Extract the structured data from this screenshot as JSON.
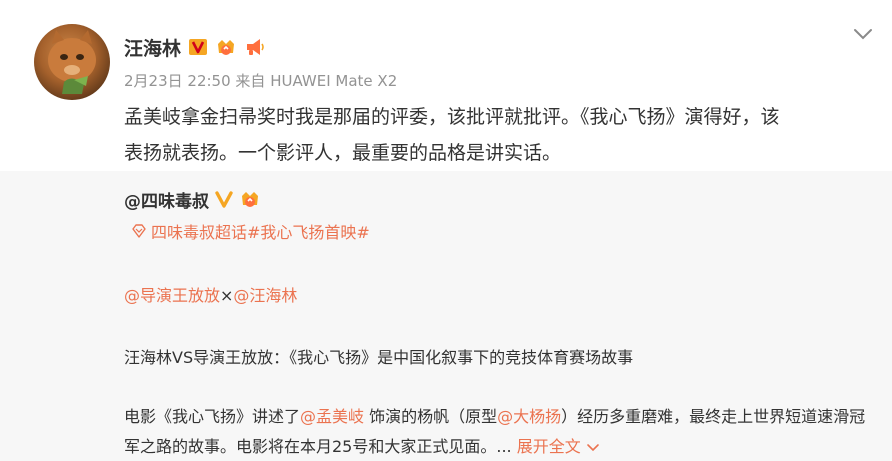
{
  "post": {
    "author": "汪海林",
    "timestamp": "2月23日 22:50",
    "source_prefix": "来自",
    "source_device": "HUAWEI Mate X2",
    "text_line1": "孟美岐拿金扫帚奖时我是那届的评委，该批评就批评。《我心飞扬》演得好，该",
    "text_line2": "表扬就表扬。一个影评人，最重要的品格是讲实话。",
    "icons": [
      "avatar",
      "verified-v-badge",
      "vip-crown-badge",
      "megaphone-badge",
      "chevron-down-icon"
    ]
  },
  "repost": {
    "author": "@四味毒叔",
    "topic_text": "四味毒叔超话#我心飞扬首映#",
    "mention1": "@导演王放放",
    "mention_sep": "×",
    "mention2": "@汪海林",
    "headline": "汪海林VS导演王放放：《我心飞扬》是中国化叙事下的竞技体育赛场故事",
    "body_part1": "电影《我心飞扬》讲述了",
    "body_mention1": "@孟美岐",
    "body_part2": " 饰演的杨帆（原型",
    "body_mention2": "@大杨扬",
    "body_part3": "）经历多重磨难，最终走上世界短道速滑冠军之路的故事。电影将在本月25号和大家正式见面。... ",
    "expand_label": "展开全文",
    "icons": [
      "verified-v-badge",
      "vip-crown-badge",
      "super-topic-icon",
      "chevron-down-icon"
    ]
  },
  "colors": {
    "link": "#eb7350",
    "text": "#333333",
    "meta": "#939393",
    "repost_bg": "#f7f7f7",
    "verified": "#f5a623"
  }
}
